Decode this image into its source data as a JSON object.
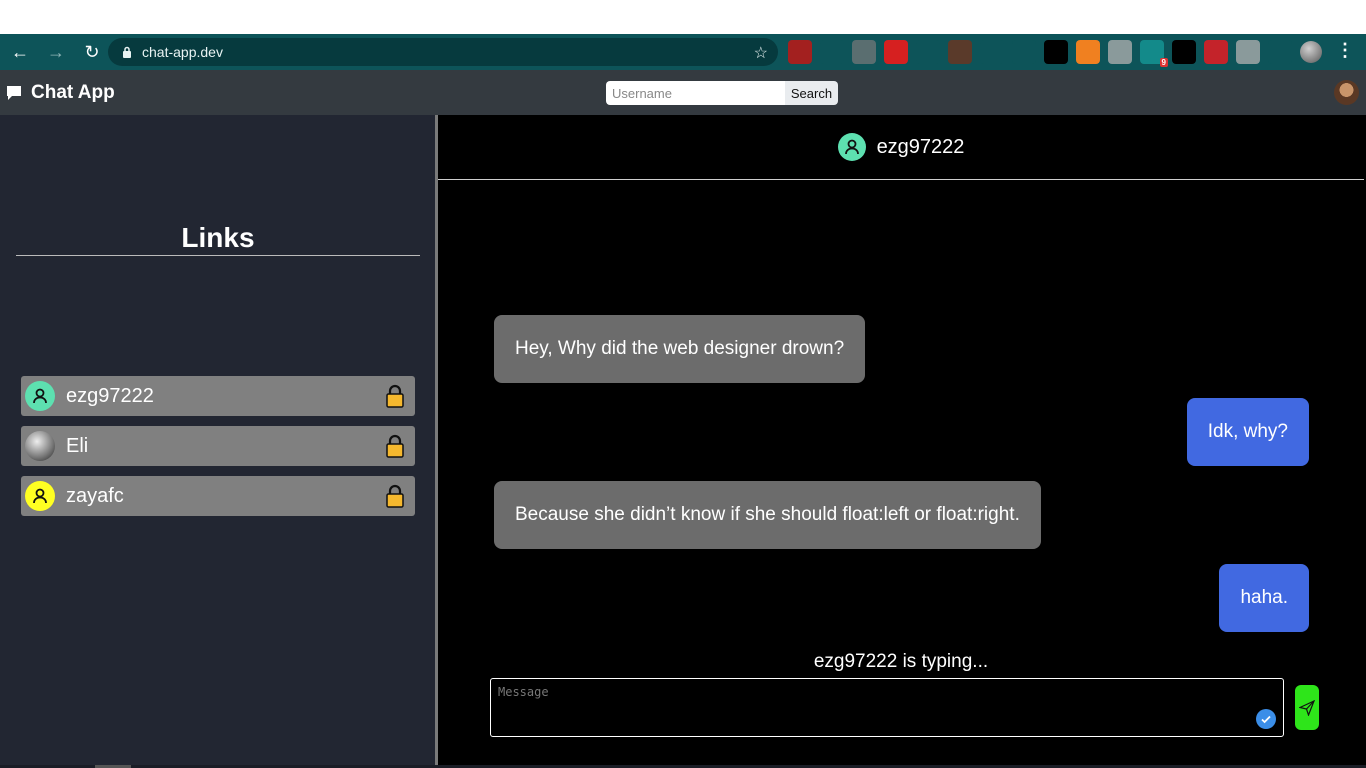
{
  "browser": {
    "url": "chat-app.dev",
    "extensions": [
      {
        "icon": "ext-red-icon",
        "color": "#a3201f"
      },
      {
        "icon": "ext-t-icon",
        "color": "#0d5459"
      },
      {
        "icon": "ext-f-icon",
        "color": "#5a6e70"
      },
      {
        "icon": "ext-hand-icon",
        "color": "#d62020"
      },
      {
        "icon": "ext-react-icon",
        "color": "#0d5459"
      },
      {
        "icon": "ext-brown-icon",
        "color": "#5a3a2a"
      },
      {
        "icon": "ext-box-icon",
        "color": "#0d5459"
      },
      {
        "icon": "ext-wave-icon",
        "color": "#0d5459"
      },
      {
        "icon": "github-icon",
        "color": "#000000"
      },
      {
        "icon": "ext-orange-icon",
        "color": "#f08020"
      },
      {
        "icon": "ext-check-icon",
        "color": "#8a9a9b"
      },
      {
        "icon": "ext-teal-icon",
        "color": "#138a8a",
        "badge": "9"
      },
      {
        "icon": "ext-w-icon",
        "color": "#000000"
      },
      {
        "icon": "ext-red-x-icon",
        "color": "#c4232a"
      },
      {
        "icon": "ext-r-icon",
        "color": "#8a9a9b"
      },
      {
        "icon": "puzzle-icon",
        "color": "#0d5459"
      }
    ]
  },
  "navbar": {
    "brand": "Chat App",
    "search_placeholder": "Username",
    "search_button": "Search"
  },
  "sidebar": {
    "title": "Links",
    "links": [
      {
        "name": "ezg97222",
        "avatar_color": "#5de0b0",
        "avatar_type": "person-icon"
      },
      {
        "name": "Eli",
        "avatar_color": "#cccccc",
        "avatar_type": "photo"
      },
      {
        "name": "zayafc",
        "avatar_color": "#ffff22",
        "avatar_type": "person-icon"
      }
    ]
  },
  "chat": {
    "header_name": "ezg97222",
    "messages": [
      {
        "direction": "in",
        "text": "Hey, Why did the web designer drown?"
      },
      {
        "direction": "out",
        "text": "Idk, why?"
      },
      {
        "direction": "in",
        "text": "Because she didn’t know if she should float:left or float:right."
      },
      {
        "direction": "out",
        "text": "haha."
      }
    ],
    "typing_status": "ezg97222 is typing...",
    "input_placeholder": "Message"
  },
  "colors": {
    "incoming_bubble": "#6c6c6c",
    "outgoing_bubble": "#4169e1",
    "send_button": "#2ee51a",
    "sidebar_bg": "#222632",
    "navbar_bg": "#343a40",
    "lock_color": "#f5b82e"
  }
}
